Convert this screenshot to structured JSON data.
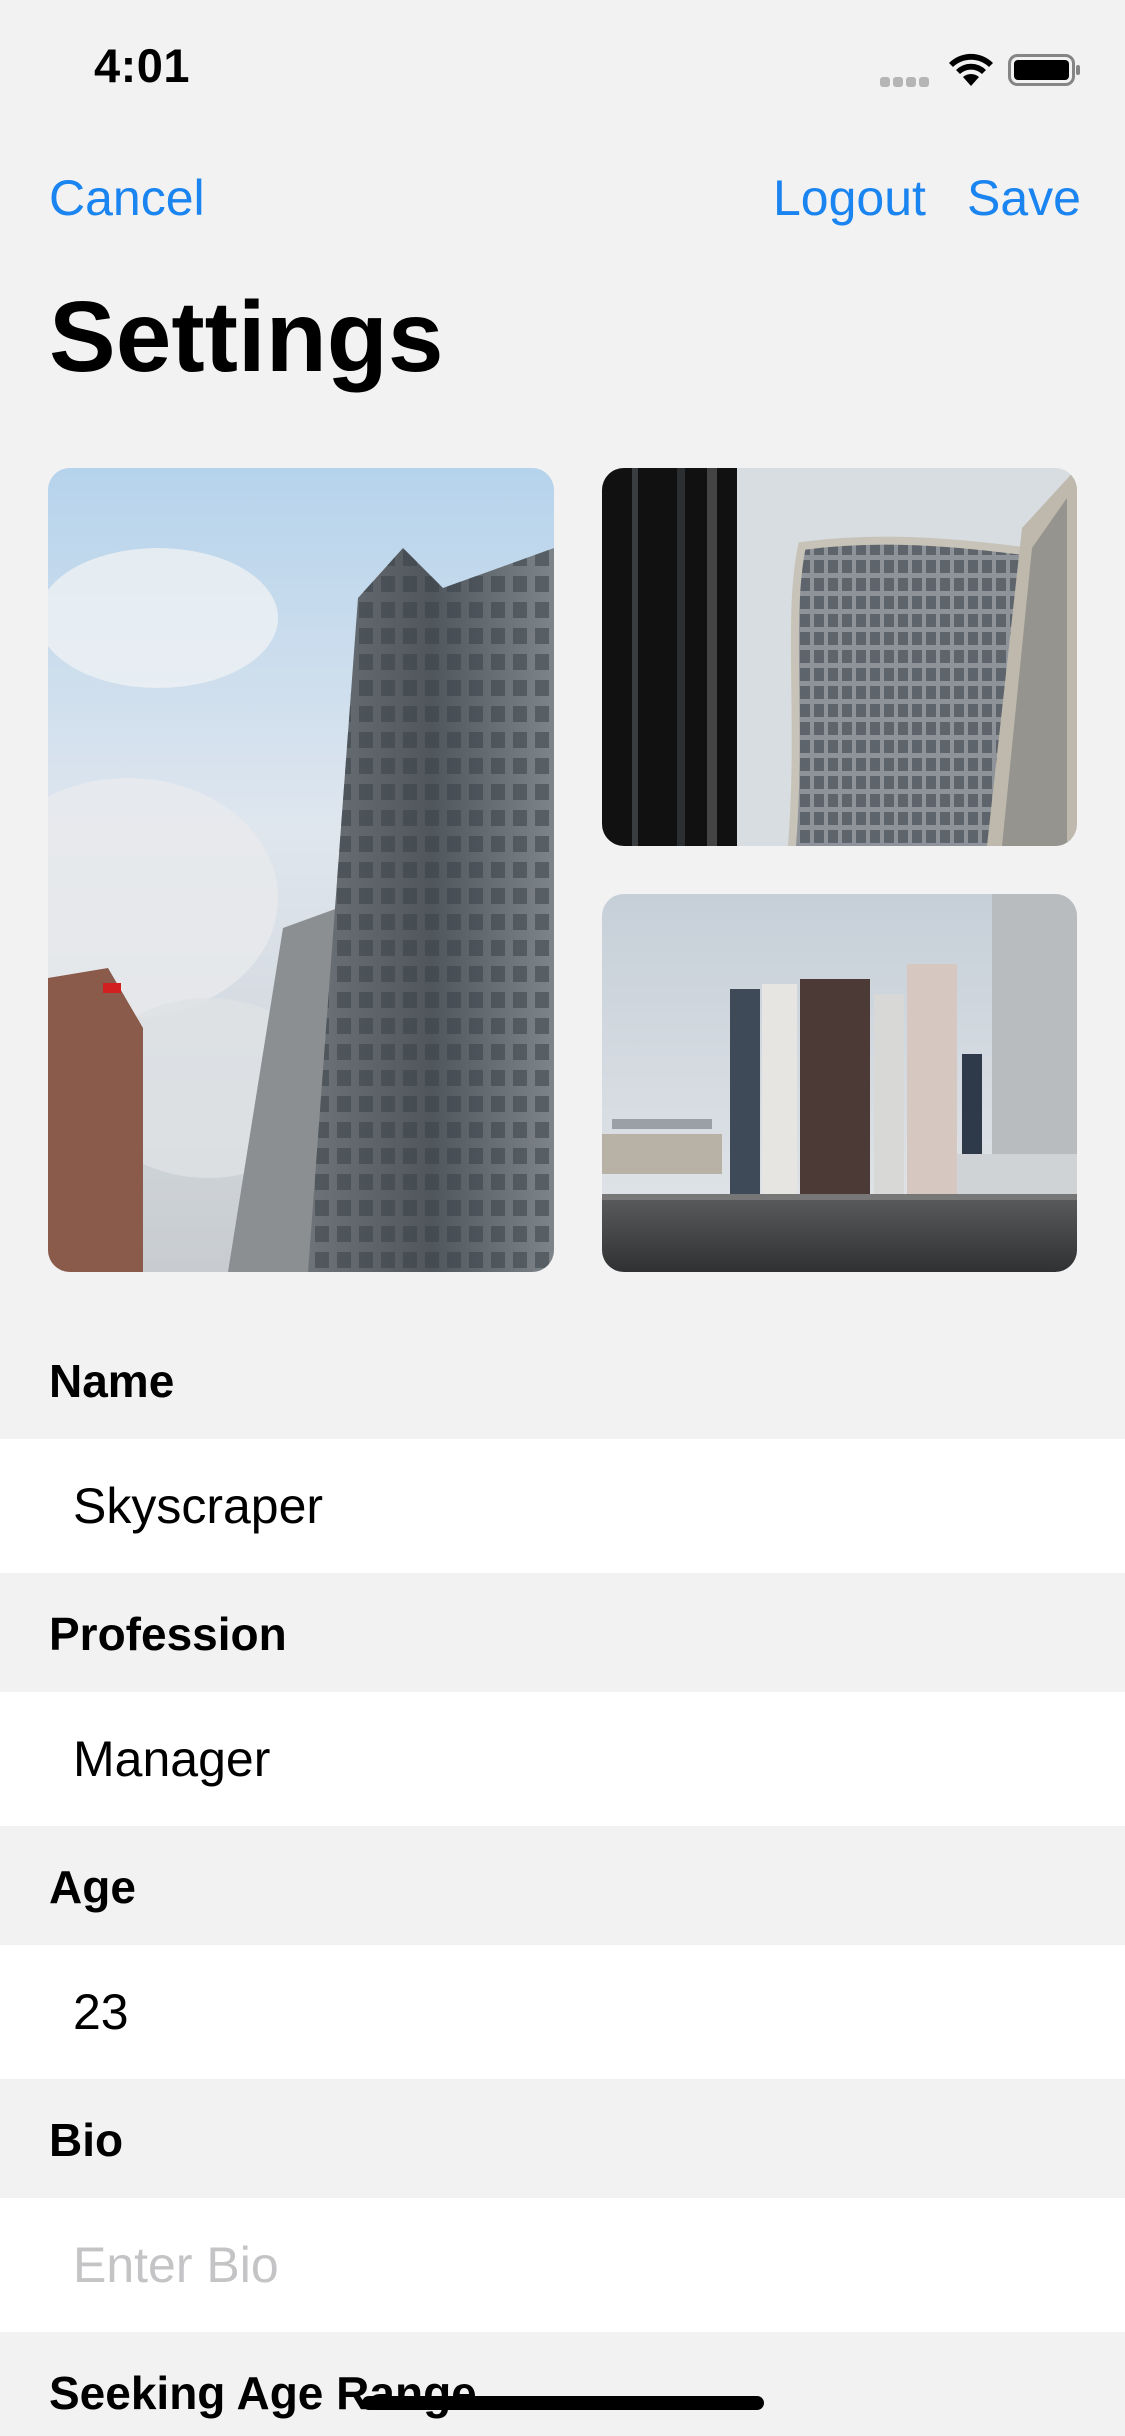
{
  "status_bar": {
    "time": "4:01",
    "icons": [
      "signal-icon",
      "wifi-icon",
      "battery-icon"
    ]
  },
  "nav": {
    "cancel_label": "Cancel",
    "logout_label": "Logout",
    "save_label": "Save"
  },
  "title": "Settings",
  "colors": {
    "accent": "#1a84f0",
    "background": "#f2f2f2",
    "field_background": "#ffffff",
    "placeholder": "#c4c4c6"
  },
  "photos": [
    {
      "name": "photo-main"
    },
    {
      "name": "photo-top-right"
    },
    {
      "name": "photo-bottom-right"
    }
  ],
  "form": {
    "name": {
      "label": "Name",
      "value": "Skyscraper",
      "placeholder": ""
    },
    "profession": {
      "label": "Profession",
      "value": "Manager",
      "placeholder": ""
    },
    "age": {
      "label": "Age",
      "value": "23",
      "placeholder": ""
    },
    "bio": {
      "label": "Bio",
      "value": "",
      "placeholder": "Enter Bio"
    },
    "seeking_age_range": {
      "label": "Seeking Age Range"
    }
  }
}
